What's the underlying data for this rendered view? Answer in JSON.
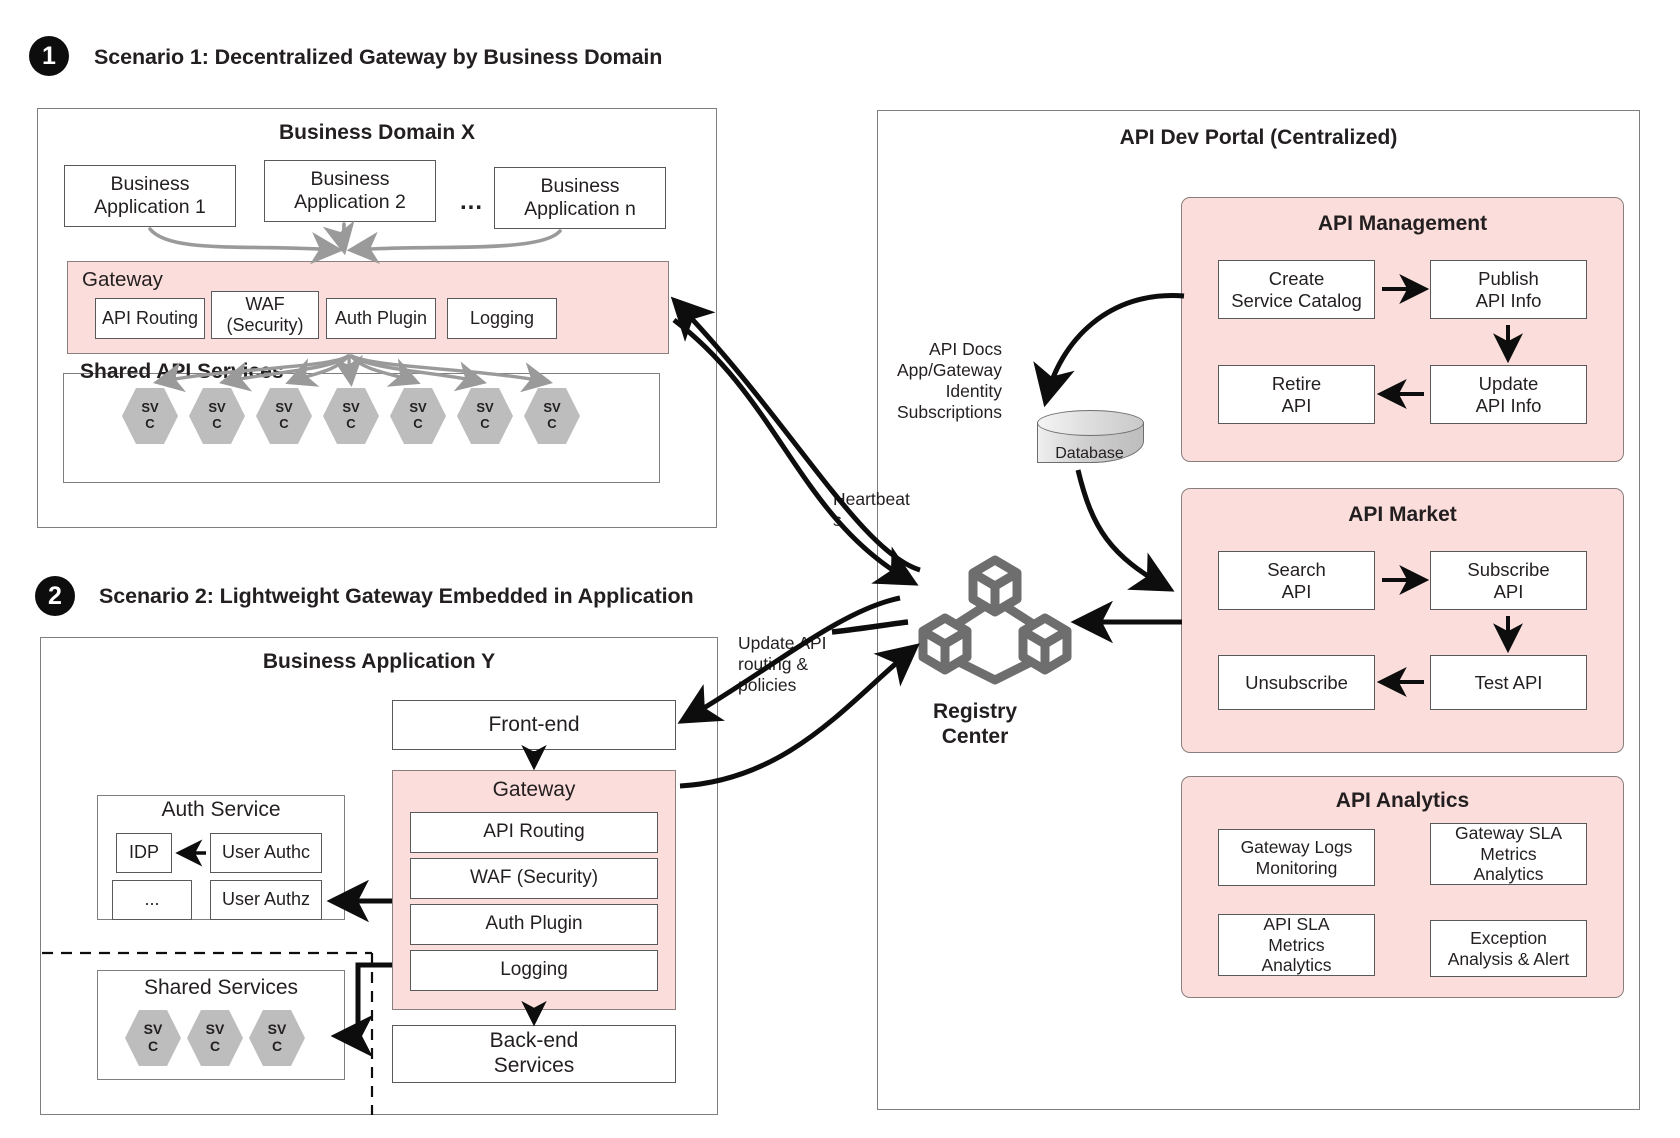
{
  "scenario1": {
    "number": "1",
    "title": "Scenario 1: Decentralized Gateway by Business Domain",
    "domain_title": "Business Domain X",
    "apps": [
      "Business\nApplication 1",
      "Business\nApplication 2",
      "Business\nApplication n"
    ],
    "app1_line1": "Business",
    "app1_line2": "Application 1",
    "app2_line1": "Business",
    "app2_line2": "Application 2",
    "app3_line1": "Business",
    "app3_line2": "Application n",
    "ellipsis": "...",
    "gateway_label": "Gateway",
    "gateway_plugins": [
      "API Routing",
      "WAF\n(Security)",
      "Auth Plugin",
      "Logging"
    ],
    "plugin_api_routing": "API Routing",
    "plugin_waf_line1": "WAF",
    "plugin_waf_line2": "(Security)",
    "plugin_auth": "Auth Plugin",
    "plugin_logging": "Logging",
    "shared_api_services_label": "Shared API Services",
    "svc_line1": "SV",
    "svc_line2": "C",
    "svc_count": 7
  },
  "scenario2": {
    "number": "2",
    "title": "Scenario 2: Lightweight Gateway Embedded in Application",
    "app_title": "Business Application Y",
    "frontend": "Front-end",
    "gateway_label": "Gateway",
    "gateway_plugins": [
      "API Routing",
      "WAF (Security)",
      "Auth Plugin",
      "Logging"
    ],
    "plugin_api_routing": "API Routing",
    "plugin_waf": "WAF (Security)",
    "plugin_auth": "Auth Plugin",
    "plugin_logging": "Logging",
    "backend_line1": "Back-end",
    "backend_line2": "Services",
    "auth_service_title": "Auth Service",
    "idp": "IDP",
    "auth_ellipsis": "...",
    "user_authc": "User Authc",
    "user_authz": "User Authz",
    "shared_services_title": "Shared Services",
    "svc_line1": "SV",
    "svc_line2": "C",
    "svc_count": 3
  },
  "portal": {
    "title": "API Dev Portal (Centralized)",
    "api_management": {
      "title": "API Management",
      "create_line1": "Create",
      "create_line2": "Service Catalog",
      "publish_line1": "Publish",
      "publish_line2": "API Info",
      "update_line1": "Update",
      "update_line2": "API Info",
      "retire_line1": "Retire",
      "retire_line2": "API"
    },
    "api_market": {
      "title": "API Market",
      "search_line1": "Search",
      "search_line2": "API",
      "subscribe_line1": "Subscribe",
      "subscribe_line2": "API",
      "test": "Test API",
      "unsubscribe": "Unsubscribe"
    },
    "api_analytics": {
      "title": "API Analytics",
      "gateway_logs_line1": "Gateway Logs",
      "gateway_logs_line2": "Monitoring",
      "gateway_sla_line1": "Gateway SLA",
      "gateway_sla_line2": "Metrics",
      "gateway_sla_line3": "Analytics",
      "api_sla_line1": "API SLA",
      "api_sla_line2": "Metrics",
      "api_sla_line3": "Analytics",
      "exception_line1": "Exception",
      "exception_line2": "Analysis & Alert"
    }
  },
  "registry": {
    "label_line1": "Registry",
    "label_line2": "Center"
  },
  "database": {
    "label": "Database"
  },
  "annotations": {
    "api_docs_line1": "API Docs",
    "api_docs_line2": "App/Gateway",
    "api_docs_line3": "Identity",
    "api_docs_line4": "Subscriptions",
    "heartbeats_line1": "Heartbeat",
    "heartbeats_line2": "s",
    "update_line1": "Update API",
    "update_line2": "routing &",
    "update_line3": "policies"
  },
  "colors": {
    "pink": "#fbdedb",
    "pink_border": "#8a7f7e",
    "box_border": "#58595b",
    "outer_border": "#7f7f7f",
    "text": "#231f20",
    "hex_fill": "#bdbdbd",
    "registry_icon": "#6e6e6e",
    "badge_bg": "#0d0d0d"
  }
}
